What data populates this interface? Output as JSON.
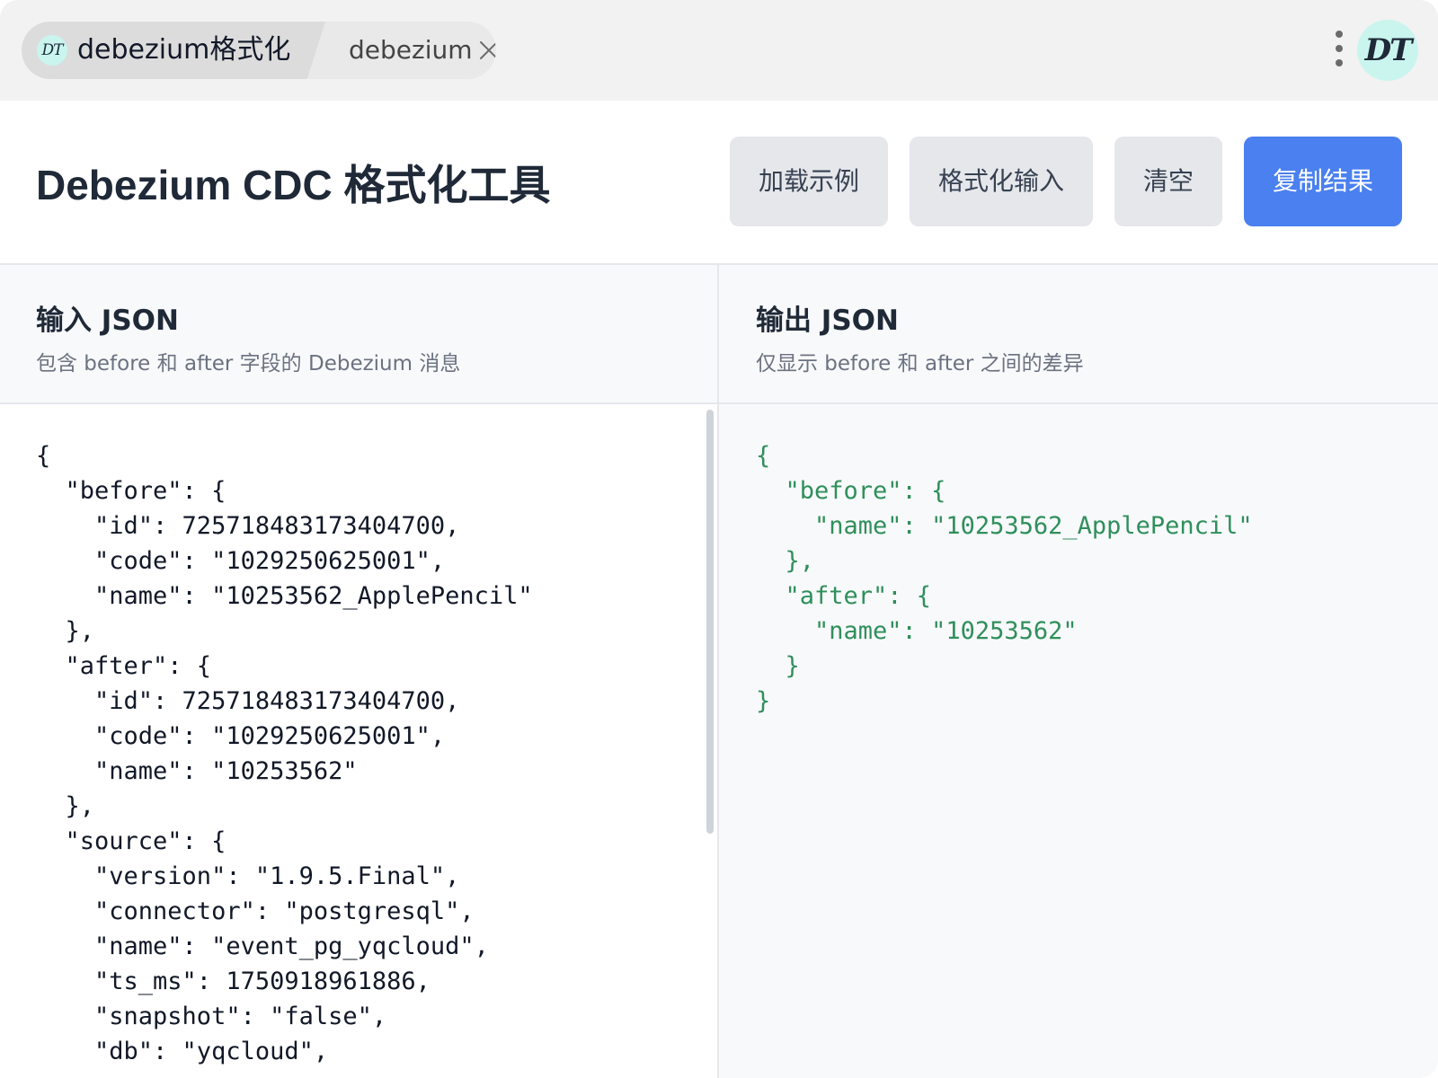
{
  "tabbar": {
    "logo_text": "DT",
    "active_tab_label": "debezium格式化",
    "inactive_tab_label": "debezium",
    "avatar_text": "DT"
  },
  "header": {
    "title": "Debezium CDC 格式化工具",
    "buttons": {
      "load_example": "加载示例",
      "format_input": "格式化输入",
      "clear": "清空",
      "copy_result": "复制结果"
    }
  },
  "input_panel": {
    "title": "输入 JSON",
    "subtitle": "包含 before 和 after 字段的 Debezium 消息",
    "code": "{\n  \"before\": {\n    \"id\": 725718483173404700,\n    \"code\": \"1029250625001\",\n    \"name\": \"10253562_ApplePencil\"\n  },\n  \"after\": {\n    \"id\": 725718483173404700,\n    \"code\": \"1029250625001\",\n    \"name\": \"10253562\"\n  },\n  \"source\": {\n    \"version\": \"1.9.5.Final\",\n    \"connector\": \"postgresql\",\n    \"name\": \"event_pg_yqcloud\",\n    \"ts_ms\": 1750918961886,\n    \"snapshot\": \"false\",\n    \"db\": \"yqcloud\","
  },
  "output_panel": {
    "title": "输出 JSON",
    "subtitle": "仅显示 before 和 after 之间的差异",
    "code": "{\n  \"before\": {\n    \"name\": \"10253562_ApplePencil\"\n  },\n  \"after\": {\n    \"name\": \"10253562\"\n  }\n}"
  },
  "colors": {
    "primary_button": "#4a80ef",
    "output_text": "#2f8f5b",
    "secondary_button": "#e5e7eb"
  },
  "icons": [
    "tab-close-icon",
    "more-options-icon",
    "logo-icon",
    "avatar-icon"
  ]
}
